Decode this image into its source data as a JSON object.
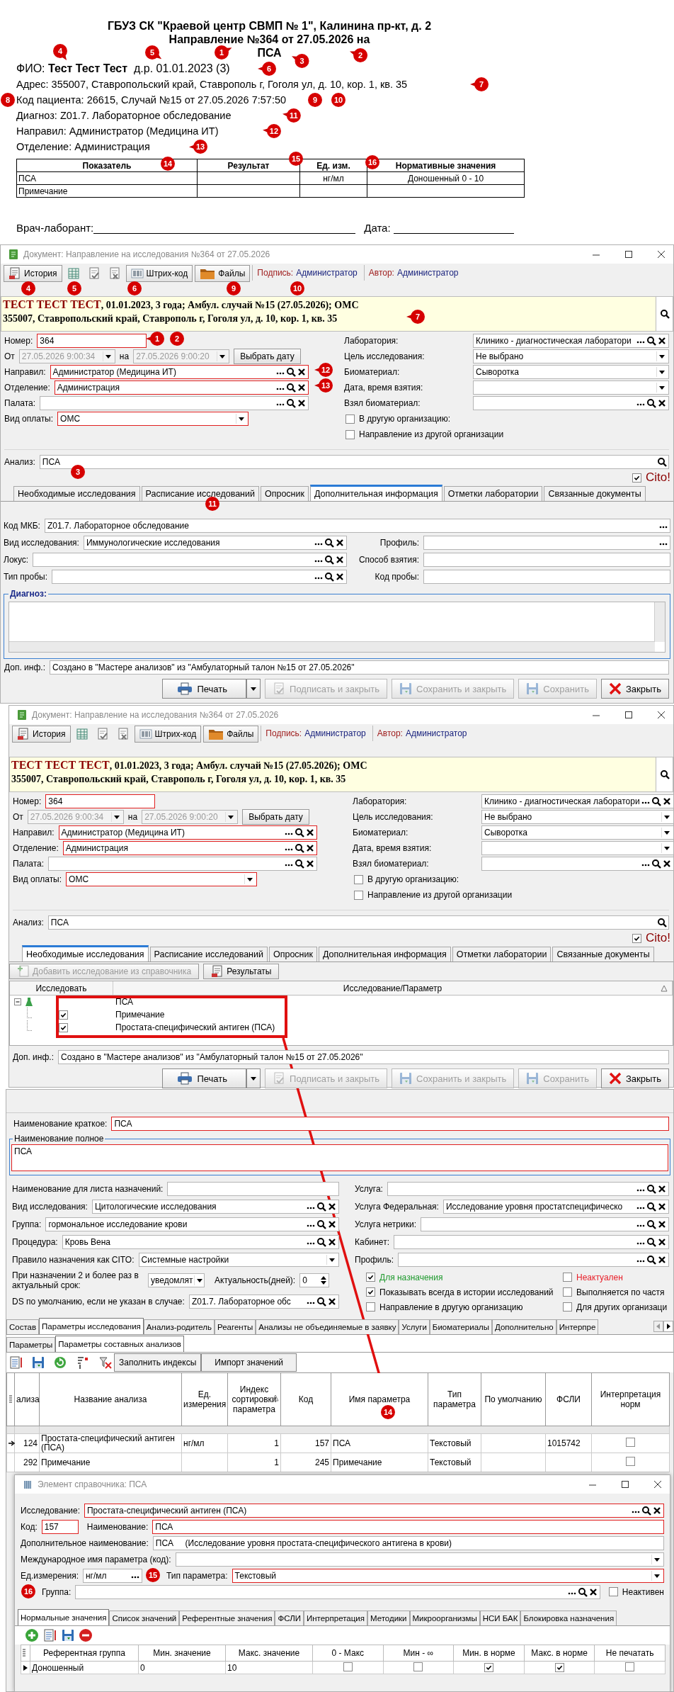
{
  "print_form": {
    "header": [
      "ГБУЗ СК \"Краевой центр СВМП № 1\", Калинина пр-кт, д. 2",
      "Направление №364 от 27.05.2026 на",
      "ПСА"
    ],
    "lines": [
      "ФИО: **Тест Тест Тест**  д.р. 01.01.2023 (3)",
      "Адрес: 355007, Ставропольский край, Ставрополь г, Гоголя ул, д. 10, кор. 1, кв. 35",
      "Код пациента: 26615, Случай №15 от 27.05.2026 7:57:50",
      "Диагноз: Z01.7. Лабораторное обследование",
      "Направил: Администратор (Медицина ИТ)",
      "Отделение: Администрация"
    ],
    "table": {
      "columns": [
        "Показатель",
        "Результат",
        "Ед. изм.",
        "Нормативные значения"
      ],
      "rows": [
        {
          "indicator": "ПСА",
          "unit": "нг/мл",
          "norm": "Доношенный 0 - 10"
        },
        {
          "indicator": "Примечание"
        }
      ]
    },
    "signatures": [
      {
        "label": "Врач-лаборант:"
      },
      {
        "label": "Дата:"
      }
    ],
    "callouts": [
      "1",
      "2",
      "3",
      "4",
      "5",
      "6",
      "7",
      "8",
      "9",
      "10",
      "11",
      "12",
      "13",
      "14",
      "15",
      "16"
    ]
  },
  "windows": [
    {
      "kind": "document",
      "title": "Документ: Направление на исследования №364 от 27.05.2026",
      "toolbar": [
        {
          "kind": "history",
          "label": "История"
        },
        {
          "kind": "grid"
        },
        {
          "kind": "sign"
        },
        {
          "kind": "unsign"
        },
        {
          "kind": "barcode",
          "label": "Штрих-код"
        },
        {
          "kind": "files",
          "label": "Файлы"
        }
      ],
      "signature": {
        "label": "Подпись:",
        "value": "Администратор"
      },
      "author": {
        "label": "Автор:",
        "value": "Администратор"
      },
      "banner": {
        "name": "ТЕСТ ТЕСТ ТЕСТ",
        "details": ", 01.01.2023, 3 года; Амбул. случай №15 (27.05.2026); ОМС",
        "address": "355007, Ставропольский край, Ставрополь г, Гоголя ул, д. 10, кор. 1, кв. 35"
      },
      "left_fields": [
        {
          "kind": "text",
          "label": "Номер:",
          "value": "364",
          "required": true,
          "short": true
        },
        {
          "kind": "date-range",
          "label": "От",
          "from": "27.05.2026 9:00:34",
          "connector": "на",
          "to": "27.05.2026 9:00:20",
          "button": "Выбрать дату",
          "disabled": true
        },
        {
          "kind": "lookup",
          "label": "Направил:",
          "value": "Администратор (Медицина ИТ)",
          "required": true
        },
        {
          "kind": "lookup",
          "label": "Отделение:",
          "value": "Администрация",
          "required": true
        },
        {
          "kind": "lookup",
          "label": "Палата:",
          "required": false
        },
        {
          "kind": "combo",
          "label": "Вид оплаты:",
          "value": "ОМС",
          "required": true,
          "short": true
        }
      ],
      "right_fields": [
        {
          "kind": "lookup",
          "label": "Лаборатория:",
          "value": "Клинико - диагностическая лаборатори",
          "required": false
        },
        {
          "kind": "combo",
          "label": "Цель исследования:",
          "value": "Не выбрано",
          "required": false
        },
        {
          "kind": "combo",
          "label": "Биоматериал:",
          "value": "Сыворотка",
          "required": false
        },
        {
          "kind": "combo",
          "label": "Дата, время взятия:",
          "required": false
        },
        {
          "kind": "lookup",
          "label": "Взял биоматериал:",
          "required": false
        },
        {
          "kind": "check",
          "label": "В другую организацию:",
          "checked": false
        },
        {
          "kind": "check",
          "label": "Направление из другой организации",
          "checked": false
        }
      ],
      "analysis": {
        "label": "Анализ:",
        "value": "ПСА"
      },
      "cito": {
        "label": "Cito!",
        "checked": true
      },
      "tabs": [
        {
          "label": "Необходимые исследования",
          "selected": false
        },
        {
          "label": "Расписание исследований",
          "selected": false
        },
        {
          "label": "Опросник",
          "selected": false
        },
        {
          "label": "Дополнительная информация",
          "selected": true
        },
        {
          "label": "Отметки лаборатории",
          "selected": false
        },
        {
          "label": "Связанные документы",
          "selected": false
        }
      ],
      "tab_content": {
        "kind": "additional",
        "rows": [
          {
            "fields": [
              {
                "kind": "picker",
                "label": "Код МКБ:",
                "value": "Z01.7. Лабораторное обследование",
                "required": false
              }
            ]
          },
          {
            "fields": [
              {
                "kind": "lookup",
                "label": "Вид исследования:",
                "value": "Иммунологические исследования",
                "required": false
              },
              {
                "kind": "picker",
                "label": "Профиль:",
                "required": false
              }
            ]
          },
          {
            "fields": [
              {
                "kind": "lookup",
                "label": "Локус:",
                "required": false
              },
              {
                "kind": "text",
                "label": "Способ взятия:",
                "required": false
              }
            ]
          },
          {
            "fields": [
              {
                "kind": "lookup",
                "label": "Тип пробы:",
                "required": false
              },
              {
                "kind": "text",
                "label": "Код пробы:",
                "required": false
              }
            ]
          }
        ],
        "memo_label": "Диагноз:"
      },
      "extra_info": {
        "label": "Доп. инф.:",
        "value": "Создано в \"Мастере анализов\" из \"Амбулаторный талон №15 от 27.05.2026\""
      },
      "buttons": [
        {
          "kind": "print",
          "label": "Печать",
          "disabled": false
        },
        {
          "kind": "sign",
          "label": "Подписать и закрыть",
          "disabled": true
        },
        {
          "kind": "save-close",
          "label": "Сохранить и закрыть",
          "disabled": true
        },
        {
          "kind": "save",
          "label": "Сохранить",
          "disabled": true
        },
        {
          "kind": "close",
          "label": "Закрыть",
          "disabled": false
        }
      ],
      "callouts": [
        "4",
        "5",
        "6",
        "9",
        "10",
        "7",
        "1",
        "2",
        "12",
        "13",
        "3",
        "11"
      ]
    },
    {
      "kind": "document",
      "title": "Документ: Направление на исследования №364 от 27.05.2026",
      "toolbar": [
        {
          "kind": "history",
          "label": "История"
        },
        {
          "kind": "grid"
        },
        {
          "kind": "sign"
        },
        {
          "kind": "unsign"
        },
        {
          "kind": "barcode",
          "label": "Штрих-код"
        },
        {
          "kind": "files",
          "label": "Файлы"
        }
      ],
      "signature": {
        "label": "Подпись:",
        "value": "Администратор"
      },
      "author": {
        "label": "Автор:",
        "value": "Администратор"
      },
      "banner": {
        "name": "ТЕСТ ТЕСТ ТЕСТ",
        "details": ", 01.01.2023, 3 года; Амбул. случай №15 (27.05.2026); ОМС",
        "address": "355007, Ставропольский край, Ставрополь г, Гоголя ул, д. 10, кор. 1, кв. 35"
      },
      "left_fields": [
        {
          "kind": "text",
          "label": "Номер:",
          "value": "364",
          "required": true,
          "short": true
        },
        {
          "kind": "date-range",
          "label": "От",
          "from": "27.05.2026 9:00:34",
          "connector": "на",
          "to": "27.05.2026 9:00:20",
          "button": "Выбрать дату",
          "disabled": true
        },
        {
          "kind": "lookup",
          "label": "Направил:",
          "value": "Администратор (Медицина ИТ)",
          "required": true
        },
        {
          "kind": "lookup",
          "label": "Отделение:",
          "value": "Администрация",
          "required": true
        },
        {
          "kind": "lookup",
          "label": "Палата:",
          "required": false
        },
        {
          "kind": "combo",
          "label": "Вид оплаты:",
          "value": "ОМС",
          "required": true,
          "short": true
        }
      ],
      "right_fields": [
        {
          "kind": "lookup",
          "label": "Лаборатория:",
          "value": "Клинико - диагностическая лаборатори",
          "required": false
        },
        {
          "kind": "combo",
          "label": "Цель исследования:",
          "value": "Не выбрано",
          "required": false
        },
        {
          "kind": "combo",
          "label": "Биоматериал:",
          "value": "Сыворотка",
          "required": false
        },
        {
          "kind": "combo",
          "label": "Дата, время взятия:",
          "required": false
        },
        {
          "kind": "lookup",
          "label": "Взял биоматериал:",
          "required": false
        },
        {
          "kind": "check",
          "label": "В другую организацию:",
          "checked": false
        },
        {
          "kind": "check",
          "label": "Направление из другой организации",
          "checked": false
        }
      ],
      "analysis": {
        "label": "Анализ:",
        "value": "ПСА"
      },
      "cito": {
        "label": "Cito!",
        "checked": true
      },
      "tabs": [
        {
          "label": "Необходимые исследования",
          "selected": true
        },
        {
          "label": "Расписание исследований",
          "selected": false
        },
        {
          "label": "Опросник",
          "selected": false
        },
        {
          "label": "Дополнительная информация",
          "selected": false
        },
        {
          "label": "Отметки лаборатории",
          "selected": false
        },
        {
          "label": "Связанные документы",
          "selected": false
        }
      ],
      "tab_content": {
        "kind": "required",
        "toolbar": [
          {
            "kind": "add-doc",
            "label": "Добавить исследование из справочника",
            "disabled": true
          },
          {
            "kind": "results",
            "label": "Результаты",
            "disabled": false
          }
        ],
        "columns": [
          {
            "label": "Исследовать",
            "sorted": false
          },
          {
            "label": "Исследование/Параметр",
            "sorted": true
          }
        ],
        "tree": [
          {
            "label": "ПСА",
            "expanded": true,
            "children": [
              {
                "label": "Примечание",
                "checked": true
              },
              {
                "label": "Простата-специфический антиген (ПСА)",
                "checked": true
              }
            ]
          }
        ]
      },
      "extra_info": {
        "label": "Доп. инф.:",
        "value": "Создано в \"Мастере анализов\" из \"Амбулаторный талон №15 от 27.05.2026\""
      },
      "buttons": [
        {
          "kind": "print",
          "label": "Печать",
          "disabled": false
        },
        {
          "kind": "sign",
          "label": "Подписать и закрыть",
          "disabled": true
        },
        {
          "kind": "save-close",
          "label": "Сохранить и закрыть",
          "disabled": true
        },
        {
          "kind": "save",
          "label": "Сохранить",
          "disabled": true
        },
        {
          "kind": "close",
          "label": "Закрыть",
          "disabled": false
        }
      ]
    },
    {
      "kind": "reference",
      "short_name": {
        "label": "Наименование краткое:",
        "value": "ПСА",
        "required": true
      },
      "full_name": {
        "label": "Наименование полное",
        "value": "ПСА",
        "required": true
      },
      "left_fields": [
        {
          "kind": "text",
          "label": "Наименование для листа назначений:",
          "required": false
        },
        {
          "kind": "lookup",
          "label": "Вид исследования:",
          "value": "Цитологические исследования",
          "required": false
        },
        {
          "kind": "lookup",
          "label": "Группа:",
          "value": "гормональное исследование крови",
          "required": false
        },
        {
          "kind": "lookup",
          "label": "Процедура:",
          "value": "Кровь Вена",
          "required": false
        },
        {
          "kind": "combo",
          "label": "Правило назначения как CITO:",
          "value": "Системные настройки",
          "required": false
        },
        {
          "kind": "notify",
          "label": "При назначении 2 и более раз в актуальный срок:",
          "value": "уведомлят",
          "label2": "Актуальность(дней):",
          "value2": "0"
        },
        {
          "kind": "lookup",
          "label": "DS по умолчанию, если не указан в случае:",
          "value": "Z01.7. Лабораторное обс",
          "required": false
        }
      ],
      "right_fields": [
        {
          "kind": "lookup",
          "label": "Услуга:",
          "required": false
        },
        {
          "kind": "lookup",
          "label": "Услуга Федеральная:",
          "value": "Исследование уровня простатспецифическо",
          "required": false
        },
        {
          "kind": "lookup",
          "label": "Услуга нетрики:",
          "required": false
        },
        {
          "kind": "lookup",
          "label": "Кабинет:",
          "required": false
        },
        {
          "kind": "lookup",
          "label": "Профиль:",
          "required": false
        }
      ],
      "checks": [
        {
          "label": "Для назначения",
          "checked": true,
          "color": "#1f9a2e"
        },
        {
          "label": "Неактуален",
          "checked": false,
          "color": "#e8202a"
        },
        {
          "label": "Показывать всегда в истории исследований",
          "checked": true,
          "color": "#000000"
        },
        {
          "label": "Выполняется по частя",
          "checked": false,
          "color": "#000000"
        },
        {
          "label": "Направление в другую организацию",
          "checked": false,
          "color": "#000000"
        },
        {
          "label": "Для других организаци",
          "checked": false,
          "color": "#000000"
        }
      ],
      "tabs": [
        {
          "label": "Состав",
          "selected": false
        },
        {
          "label": "Параметры исследования",
          "selected": true
        },
        {
          "label": "Анализ-родитель",
          "selected": false
        },
        {
          "label": "Реагенты",
          "selected": false
        },
        {
          "label": "Анализы не объединяемые в заявку",
          "selected": false
        },
        {
          "label": "Услуги",
          "selected": false
        },
        {
          "label": "Биоматериалы",
          "selected": false
        },
        {
          "label": "Дополнительно",
          "selected": false
        },
        {
          "label": "Интерпре",
          "selected": false
        }
      ],
      "subtabs": [
        {
          "label": "Параметры",
          "selected": false
        },
        {
          "label": "Параметры составных анализов",
          "selected": true
        }
      ],
      "toolbar": [
        {
          "kind": "edit"
        },
        {
          "kind": "save"
        },
        {
          "kind": "refresh"
        },
        {
          "kind": "filter"
        },
        {
          "kind": "clear-filter"
        },
        {
          "kind": "button",
          "label": "Заполнить индексы"
        },
        {
          "kind": "button",
          "label": "Импорт значений"
        }
      ],
      "table": {
        "columns": [
          {
            "label": "ализа",
            "sorted": false
          },
          {
            "label": "Название анализа",
            "sorted": false
          },
          {
            "label": "Ед. измерения",
            "sorted": false
          },
          {
            "label": "Индекс сортировки параметра",
            "sorted": true
          },
          {
            "label": "Код",
            "sorted": false
          },
          {
            "label": "Имя параметра",
            "sorted": false
          },
          {
            "label": "Тип параметра",
            "sorted": false
          },
          {
            "label": "По умолчанию",
            "sorted": false
          },
          {
            "label": "ФСЛИ",
            "sorted": false
          },
          {
            "label": "Интерпретация норм",
            "sorted": false
          }
        ],
        "rows": [
          {
            "selected": true,
            "number": "124",
            "name": "Простата-специфический антиген (ПСА)",
            "unit": "нг/мл",
            "sort_index": "1",
            "code": "157",
            "param_name": "ПСА",
            "param_type": "Текстовый",
            "fsli": "1015742",
            "interpretation": false
          },
          {
            "selected": false,
            "number": "292",
            "name": "Примечание",
            "sort_index": "1",
            "code": "245",
            "param_name": "Примечание",
            "param_type": "Текстовый",
            "interpretation": false
          }
        ]
      },
      "callouts": [
        "14"
      ]
    },
    {
      "kind": "parameter",
      "title": "Элемент справочника: ПСА",
      "rows": [
        {
          "fields": [
            {
              "kind": "lookup",
              "label": "Исследование:",
              "value": "Простата-специфический антиген (ПСА)",
              "required": true
            }
          ]
        },
        {
          "fields": [
            {
              "kind": "text",
              "label": "Код:",
              "value": "157",
              "required": true,
              "short": true
            },
            {
              "kind": "text",
              "label": "Наименование:",
              "value": "ПСА",
              "required": true
            }
          ]
        },
        {
          "fields": [
            {
              "kind": "text",
              "label": "Дополнительное наименование:",
              "value": "ПСА     (Исследование уровня простата-специфического антигена в крови)",
              "required": false
            }
          ]
        },
        {
          "fields": [
            {
              "kind": "combo",
              "label": "Международное имя параметра (код):",
              "required": false
            }
          ]
        },
        {
          "fields": [
            {
              "kind": "picker",
              "label": "Ед.измерения:",
              "value": "нг/мл",
              "required": false,
              "short": true
            },
            {
              "kind": "combo",
              "label": "Тип параметра:",
              "value": "Текстовый",
              "required": true
            }
          ]
        },
        {
          "fields": [
            {
              "kind": "lookup",
              "label": "Группа:",
              "required": false
            },
            {
              "kind": "check",
              "label": "Неактивен",
              "checked": false
            }
          ]
        }
      ],
      "tabs": [
        {
          "label": "Нормальные значения",
          "selected": true
        },
        {
          "label": "Список значений",
          "selected": false
        },
        {
          "label": "Референтные значения",
          "selected": false
        },
        {
          "label": "ФСЛИ",
          "selected": false
        },
        {
          "label": "Интерпретация",
          "selected": false
        },
        {
          "label": "Методики",
          "selected": false
        },
        {
          "label": "Микроорганизмы",
          "selected": false
        },
        {
          "label": "НСИ БАК",
          "selected": false
        },
        {
          "label": "Блокировка назначения",
          "selected": false
        }
      ],
      "toolbar": [
        {
          "kind": "add"
        },
        {
          "kind": "edit"
        },
        {
          "kind": "save"
        },
        {
          "kind": "delete"
        }
      ],
      "table": {
        "columns": [
          "Референтная группа",
          "Мин. значение",
          "Макс. значение",
          "0 - Макс",
          "Мин - ∞",
          "Мин. в норме",
          "Макс. в норме",
          "Не печатать"
        ],
        "rows": [
          {
            "selected": true,
            "group": "Доношенный",
            "min": "0",
            "max": "10",
            "zero_max": false,
            "min_inf": false,
            "min_normal": true,
            "max_normal": true,
            "no_print": false
          }
        ]
      },
      "callouts": [
        "15",
        "16"
      ]
    }
  ]
}
